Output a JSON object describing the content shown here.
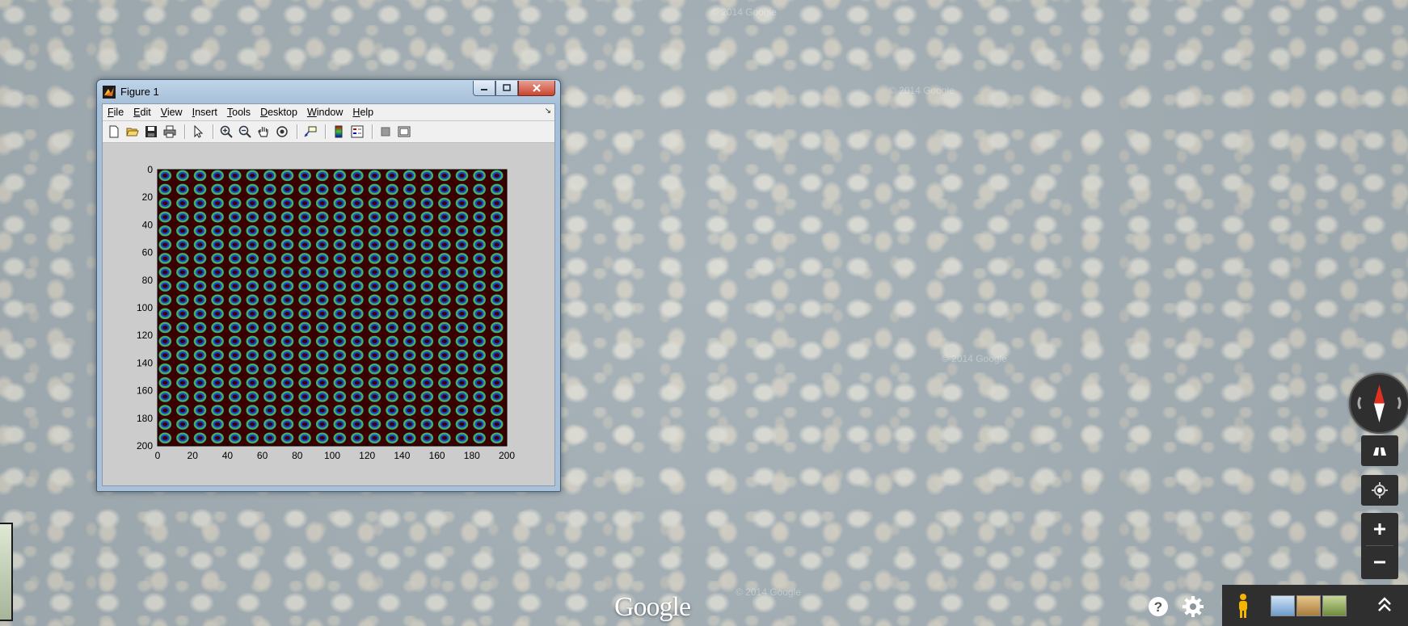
{
  "window": {
    "title": "Figure 1",
    "buttons": {
      "minimize_icon": "minimize-icon",
      "maximize_icon": "maximize-icon",
      "close_icon": "close-icon"
    }
  },
  "menubar": {
    "items": [
      {
        "pre": "",
        "mn": "F",
        "rest": "ile"
      },
      {
        "pre": "",
        "mn": "E",
        "rest": "dit"
      },
      {
        "pre": "",
        "mn": "V",
        "rest": "iew"
      },
      {
        "pre": "",
        "mn": "I",
        "rest": "nsert"
      },
      {
        "pre": "",
        "mn": "T",
        "rest": "ools"
      },
      {
        "pre": "",
        "mn": "D",
        "rest": "esktop"
      },
      {
        "pre": "",
        "mn": "W",
        "rest": "indow"
      },
      {
        "pre": "",
        "mn": "H",
        "rest": "elp"
      }
    ]
  },
  "toolbar": {
    "icons": [
      "new-figure-icon",
      "open-file-icon",
      "save-icon",
      "print-icon",
      "select-arrow-icon",
      "zoom-in-icon",
      "zoom-out-icon",
      "pan-hand-icon",
      "rotate-3d-icon",
      "data-cursor-icon",
      "colorbar-icon",
      "legend-icon",
      "hide-plot-tools-icon",
      "show-plot-tools-icon"
    ]
  },
  "chart_data": {
    "type": "heatmap",
    "title": "",
    "xlabel": "",
    "ylabel": "",
    "xlim": [
      0,
      200
    ],
    "ylim": [
      200,
      0
    ],
    "xticks": [
      0,
      20,
      40,
      60,
      80,
      100,
      120,
      140,
      160,
      180,
      200
    ],
    "yticks": [
      0,
      20,
      40,
      60,
      80,
      100,
      120,
      140,
      160,
      180,
      200
    ],
    "colormap": [
      "#3a0000",
      "#1d3fd0",
      "#1f9bd6",
      "#3fd27a",
      "#d6d63a"
    ],
    "background_color": "#3a0000",
    "pattern": "grid of ring-shaped spots spaced ~10 units apart"
  },
  "map": {
    "logo": "Google",
    "watermark": "© 2014 Google",
    "controls": {
      "compass": "compass-icon",
      "tilt": "tilt-view-icon",
      "location": "my-location-icon",
      "zoom_in": "zoom-in-plus-icon",
      "zoom_out": "zoom-out-minus-icon",
      "pegman": "pegman-icon",
      "help": "help-icon",
      "settings": "gear-icon",
      "expand": "expand-up-icon"
    },
    "colors": {
      "terrain": "#a4b0b6",
      "spots": "#dedcd4",
      "controls_bg": "#2f2f2f"
    }
  }
}
